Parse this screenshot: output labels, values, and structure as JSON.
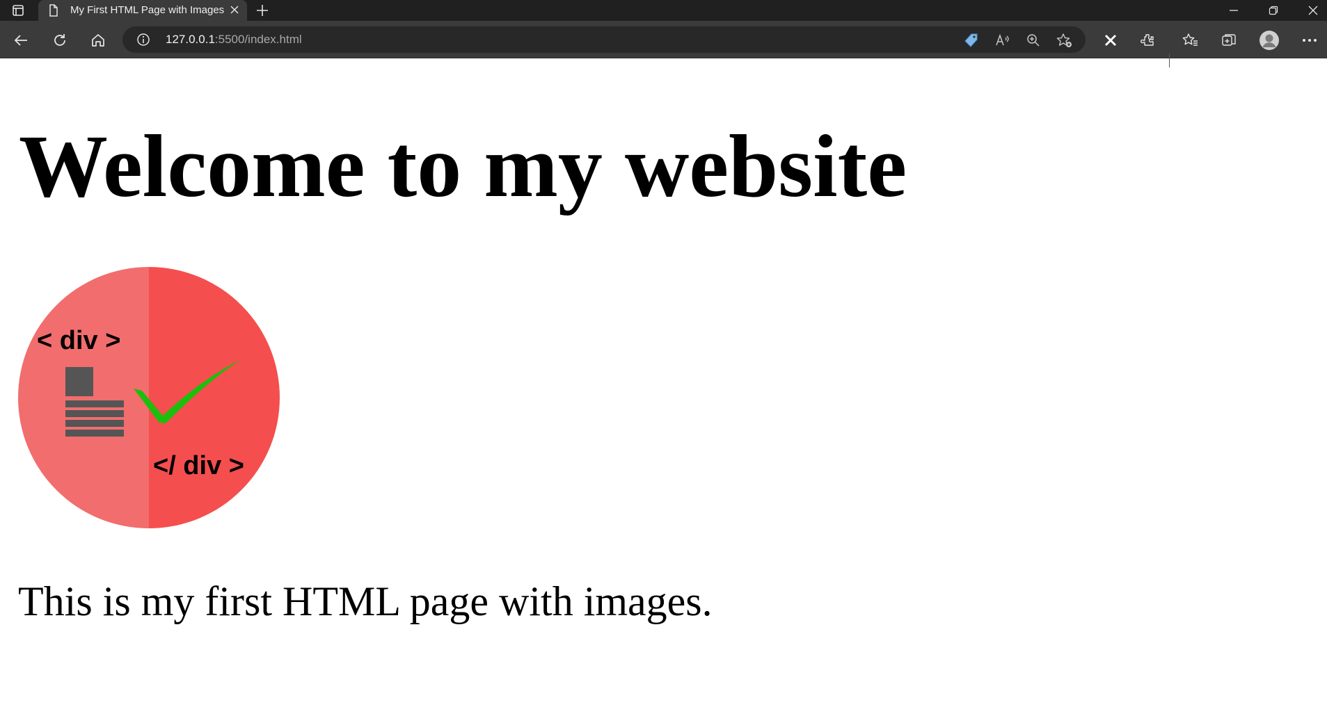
{
  "tab": {
    "title": "My First HTML Page with Images"
  },
  "address_bar": {
    "host": "127.0.0.1",
    "path": ":5500/index.html"
  },
  "page": {
    "heading": "Welcome to my website",
    "image": {
      "open_tag": "< div >",
      "close_tag": "</ div >"
    },
    "paragraph": "This is my first HTML page with images."
  },
  "colors": {
    "logo_left": "#f26d6d",
    "logo_right": "#f54e4e",
    "check": "#1bbf0c"
  }
}
